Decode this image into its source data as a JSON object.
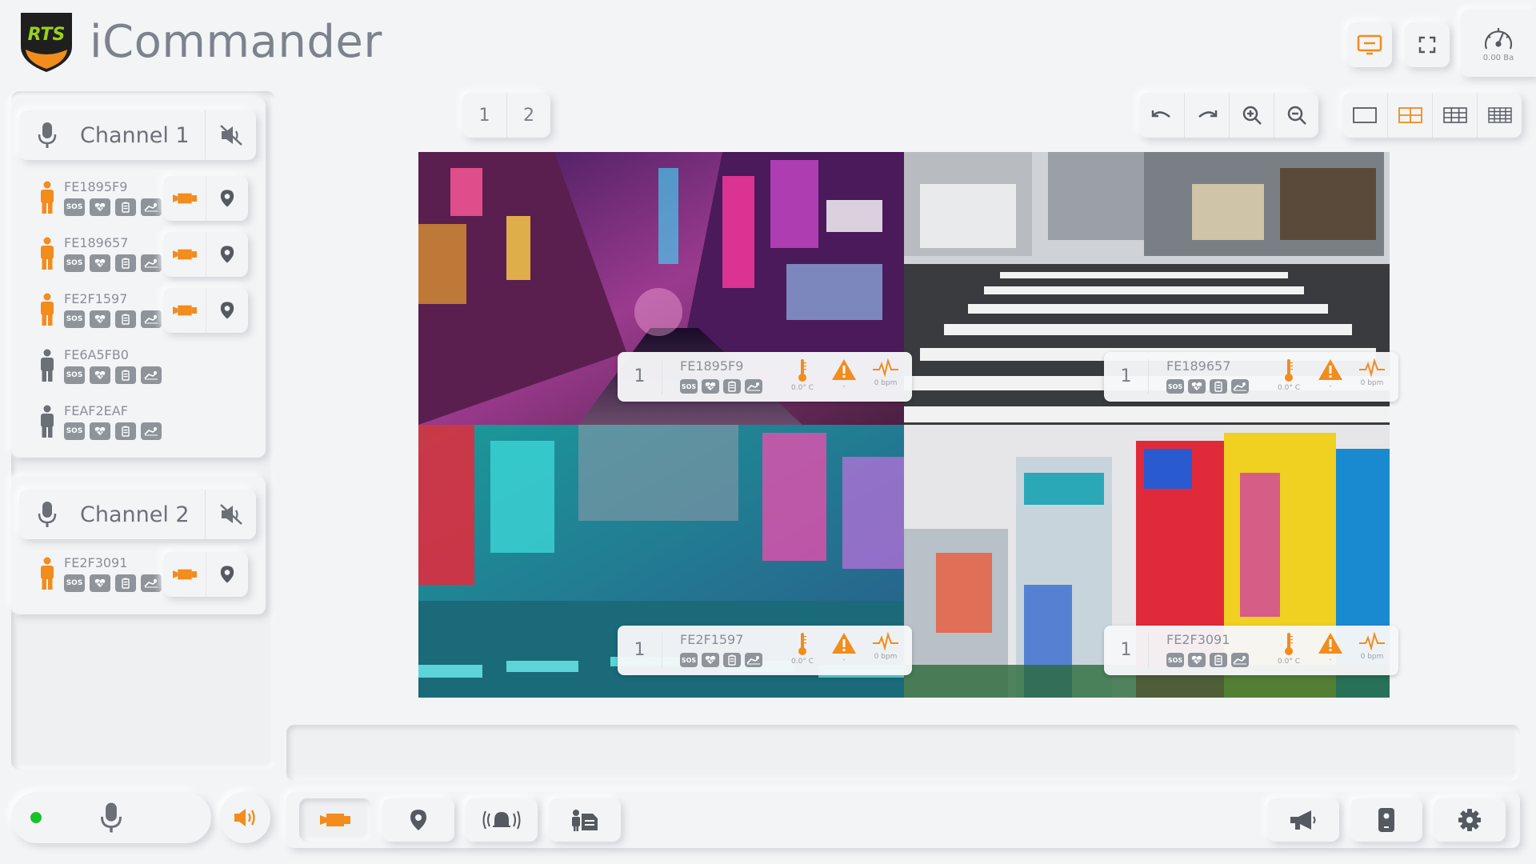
{
  "app": {
    "title": "iCommander",
    "logo_text": "RTS",
    "speed_value": "0.00 Ba"
  },
  "colors": {
    "accent": "#f28c1c",
    "icon_gray": "#6b6f76",
    "status_online": "#18c22a",
    "active_border": "#d2242a"
  },
  "channels": [
    {
      "label": "Channel 1",
      "users": [
        {
          "id": "FE1895F9",
          "active": true
        },
        {
          "id": "FE189657",
          "active": true
        },
        {
          "id": "FE2F1597",
          "active": true
        },
        {
          "id": "FE6A5FB0",
          "active": false
        },
        {
          "id": "FEAF2EAF",
          "active": false
        }
      ]
    },
    {
      "label": "Channel 2",
      "users": [
        {
          "id": "FE2F3091",
          "active": true
        }
      ]
    }
  ],
  "status_icons": [
    "sos",
    "heart",
    "battery",
    "fall"
  ],
  "status_icon_labels": {
    "sos": "SOS"
  },
  "pages": [
    "1",
    "2"
  ],
  "video_tiles": [
    {
      "channel": "1",
      "device_id": "FE1895F9",
      "temp": "0.0° C",
      "alert": "-",
      "heart_rate": "0 bpm"
    },
    {
      "channel": "1",
      "device_id": "FE189657",
      "temp": "0.0° C",
      "alert": "-",
      "heart_rate": "0 bpm"
    },
    {
      "channel": "1",
      "device_id": "FE2F1597",
      "temp": "0.0° C",
      "alert": "-",
      "heart_rate": "0 bpm"
    },
    {
      "channel": "1",
      "device_id": "FE2F3091",
      "temp": "0.0° C",
      "alert": "-",
      "heart_rate": "0 bpm"
    }
  ],
  "toolbar": {
    "history": [
      "undo-icon",
      "redo-icon",
      "zoom-in-icon",
      "zoom-out-icon"
    ],
    "layouts": [
      "layout-1x1-icon",
      "layout-2x2-icon",
      "layout-3x3-icon",
      "layout-4x4-icon"
    ],
    "selected_layout": "layout-2x2-icon"
  },
  "bottom_bar": {
    "left": [
      "video-icon",
      "location-icon",
      "alarm-icon",
      "user-report-icon"
    ],
    "right": [
      "megaphone-icon",
      "device-icon",
      "settings-icon"
    ],
    "selected": "video-icon"
  }
}
